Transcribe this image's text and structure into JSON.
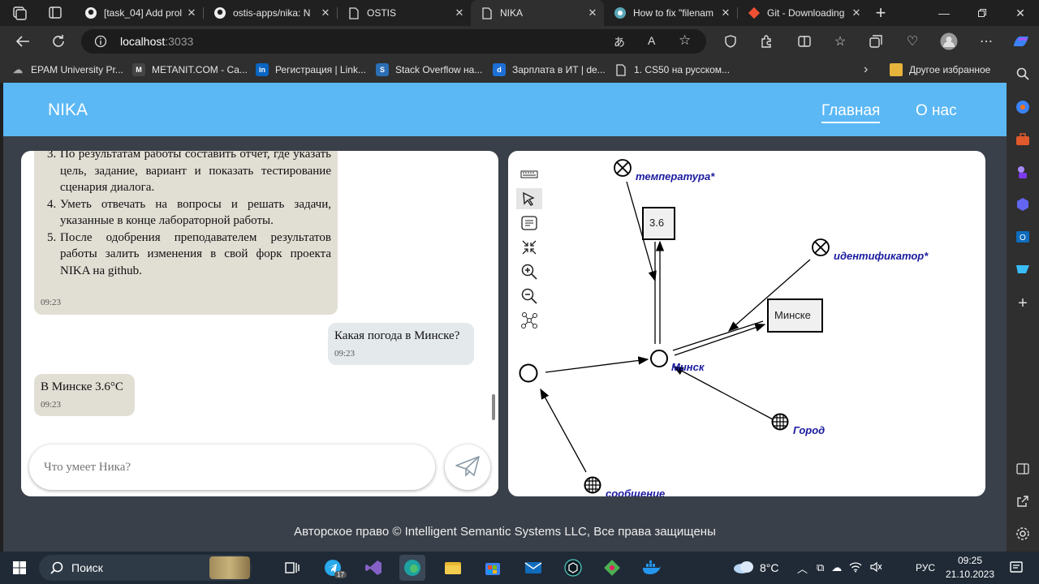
{
  "browser": {
    "tabs": [
      {
        "title": "[task_04] Add prol",
        "icon": "github-icon"
      },
      {
        "title": "ostis-apps/nika: N",
        "icon": "github-icon"
      },
      {
        "title": "OSTIS",
        "icon": "page-icon"
      },
      {
        "title": "NIKA",
        "icon": "page-icon"
      },
      {
        "title": "How to fix \"filenam",
        "icon": "forum-icon"
      },
      {
        "title": "Git - Downloading",
        "icon": "git-icon"
      }
    ],
    "new_tab_label": "+",
    "url_host": "localhost",
    "url_port": ":3033",
    "bookmarks": [
      {
        "label": "EPAM University Pr...",
        "color": "#777777"
      },
      {
        "label": "METANIT.COM - Са...",
        "color": "#444444"
      },
      {
        "label": "Регистрация | Link...",
        "color": "#0a66c2"
      },
      {
        "label": "Stack Overflow на...",
        "color": "#2b6fb5"
      },
      {
        "label": "Зарплата в ИТ | de...",
        "color": "#1d6fd6"
      },
      {
        "label": "1. CS50 на русском...",
        "color": "#666666"
      }
    ],
    "bookmarks_other": "Другое избранное"
  },
  "app": {
    "brand": "NIKA",
    "nav": [
      {
        "label": "Главная",
        "active": true
      },
      {
        "label": "О нас",
        "active": false
      }
    ],
    "footer": "Авторское право © Intelligent Semantic Systems LLC, Все права защищены"
  },
  "chat": {
    "list_items": [
      {
        "num": "3.",
        "text": "По результатам работы составить отчет, где указать цель, задание, вариант и показать тестирование сценария диалога."
      },
      {
        "num": "4.",
        "text": "Уметь отвечать на вопросы и решать задачи, указанные в конце лабораторной работы."
      },
      {
        "num": "5.",
        "text": "После одобрения преподавателем результатов работы залить изменения в свой форк проекта NIKA на github."
      }
    ],
    "msg1_time": "09:23",
    "user_msg": "Какая погода в Минске?",
    "user_time": "09:23",
    "bot_msg": "В Минске 3.6°C",
    "bot_time": "09:23",
    "input_placeholder": "Что умеет Ника?"
  },
  "graph": {
    "nodes": {
      "temperature": "температура*",
      "value": "3.6",
      "identifier": "идентификатор*",
      "minske": "Минске",
      "minsk": "Минск",
      "city": "Город",
      "message": "сообщение"
    }
  },
  "taskbar": {
    "search_label": "Поиск",
    "weather": "8°C",
    "lang": "РУС",
    "time": "09:25",
    "date": "21.10.2023",
    "telegram_badge": "17"
  }
}
